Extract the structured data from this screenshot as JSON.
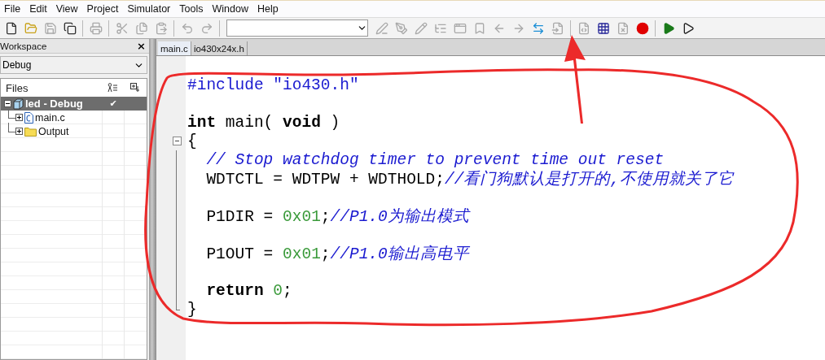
{
  "menu": [
    "File",
    "Edit",
    "View",
    "Project",
    "Simulator",
    "Tools",
    "Window",
    "Help"
  ],
  "toolbar": [
    {
      "kind": "new",
      "disabled": false
    },
    {
      "kind": "open",
      "disabled": false
    },
    {
      "kind": "save",
      "disabled": true
    },
    {
      "kind": "save_all",
      "disabled": false
    },
    {
      "kind": "separator"
    },
    {
      "kind": "print",
      "disabled": true
    },
    {
      "kind": "separator"
    },
    {
      "kind": "cut",
      "disabled": true
    },
    {
      "kind": "copy",
      "disabled": true
    },
    {
      "kind": "paste",
      "disabled": true
    },
    {
      "kind": "separator"
    },
    {
      "kind": "undo",
      "disabled": true
    },
    {
      "kind": "redo",
      "disabled": true
    },
    {
      "kind": "separator"
    },
    {
      "kind": "combo"
    },
    {
      "kind": "pen",
      "disabled": true
    },
    {
      "kind": "pen_tool",
      "disabled": true
    },
    {
      "kind": "pencil",
      "disabled": true
    },
    {
      "kind": "tree",
      "disabled": true
    },
    {
      "kind": "window",
      "disabled": true
    },
    {
      "kind": "bookmark",
      "disabled": true
    },
    {
      "kind": "back",
      "disabled": true
    },
    {
      "kind": "forward",
      "disabled": true
    },
    {
      "kind": "swap",
      "disabled": false
    },
    {
      "kind": "file_input",
      "disabled": true
    },
    {
      "kind": "separator"
    },
    {
      "kind": "compile",
      "disabled": true
    },
    {
      "kind": "make",
      "disabled": false
    },
    {
      "kind": "stop",
      "disabled": true
    },
    {
      "kind": "breakpoint",
      "disabled": false
    },
    {
      "kind": "separator"
    },
    {
      "kind": "debug",
      "disabled": false
    },
    {
      "kind": "debug_outline",
      "disabled": false
    }
  ],
  "workspace": {
    "title": "Workspace",
    "close": "×",
    "configuration": "Debug",
    "files_header": "Files",
    "tree": [
      {
        "label": "led - Debug",
        "kind": "project",
        "selected": true,
        "expanded": true,
        "column_2": "✔",
        "children": [
          {
            "label": "main.c",
            "kind": "file",
            "selected": false,
            "expanded": false
          },
          {
            "label": "Output",
            "kind": "folder",
            "selected": false,
            "expanded": false
          }
        ]
      }
    ]
  },
  "editor": {
    "tabs": [
      {
        "label": "main.c",
        "selected": true
      },
      {
        "label": "io430x24x.h",
        "selected": false
      }
    ],
    "lines": [
      {
        "kind": "code",
        "tokens": [
          {
            "kind": "preproc",
            "text": "#include \"io430.h\""
          }
        ]
      },
      {
        "kind": "blank"
      },
      {
        "kind": "code",
        "tokens": [
          {
            "kind": "keyword",
            "text": "int"
          },
          {
            "kind": "plain",
            "text": " main( "
          },
          {
            "kind": "keyword",
            "text": "void"
          },
          {
            "kind": "plain",
            "text": " )"
          }
        ]
      },
      {
        "kind": "fold_start",
        "tokens": [
          {
            "kind": "plain",
            "text": "{"
          }
        ]
      },
      {
        "kind": "code",
        "tokens": [
          {
            "kind": "comment",
            "text": "  // Stop watchdog timer to prevent time out reset"
          }
        ]
      },
      {
        "kind": "code",
        "tokens": [
          {
            "kind": "plain",
            "text": "  WDTCTL = WDTPW + WDTHOLD;"
          },
          {
            "kind": "comment",
            "text": "//看门狗默认是打开的,不使用就关了它"
          }
        ]
      },
      {
        "kind": "blank"
      },
      {
        "kind": "code",
        "tokens": [
          {
            "kind": "plain",
            "text": "  P1DIR = "
          },
          {
            "kind": "number",
            "text": "0x01"
          },
          {
            "kind": "plain",
            "text": ";"
          },
          {
            "kind": "comment",
            "text": "//P1.0为输出模式"
          }
        ]
      },
      {
        "kind": "blank"
      },
      {
        "kind": "code",
        "tokens": [
          {
            "kind": "plain",
            "text": "  P1OUT = "
          },
          {
            "kind": "number",
            "text": "0x01"
          },
          {
            "kind": "plain",
            "text": ";"
          },
          {
            "kind": "comment",
            "text": "//P1.0输出高电平"
          }
        ]
      },
      {
        "kind": "blank"
      },
      {
        "kind": "code",
        "tokens": [
          {
            "kind": "keyword",
            "text": "  return "
          },
          {
            "kind": "number",
            "text": "0"
          },
          {
            "kind": "plain",
            "text": ";"
          }
        ]
      },
      {
        "kind": "fold_end",
        "tokens": [
          {
            "kind": "plain",
            "text": "}"
          }
        ]
      }
    ]
  }
}
